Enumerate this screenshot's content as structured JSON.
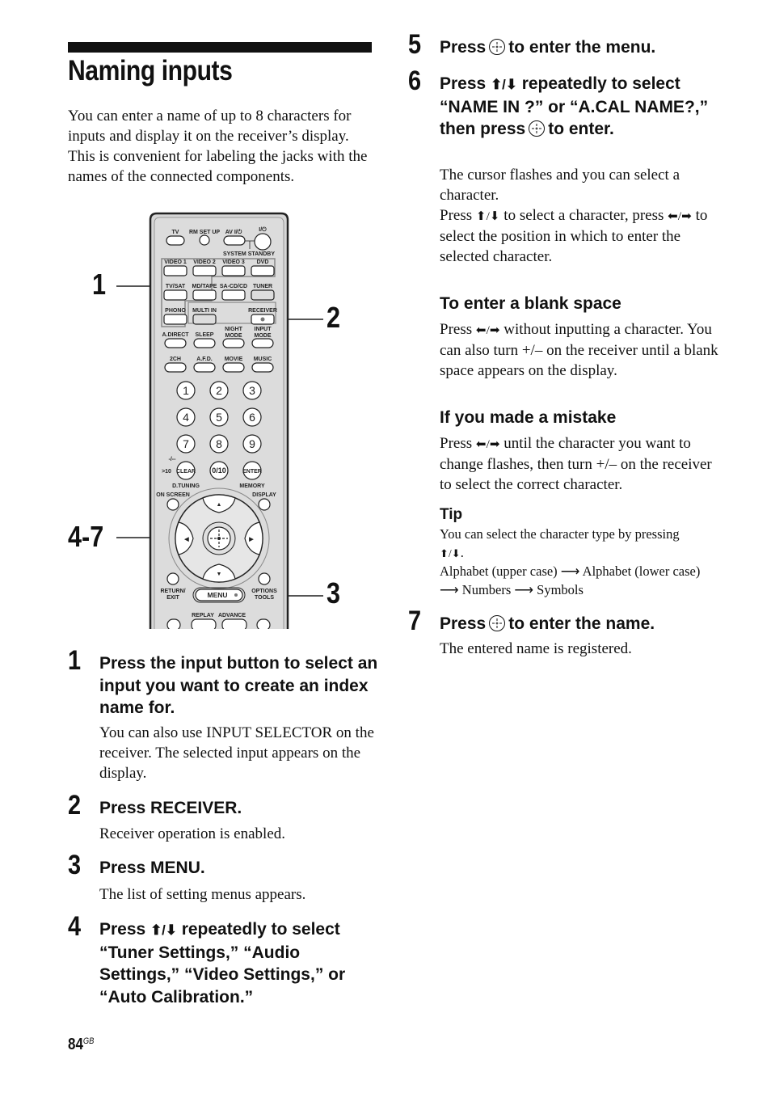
{
  "page": {
    "title": "Naming inputs",
    "intro": "You can enter a name of up to 8 characters for inputs and display it on the receiver’s display. This is convenient for labeling the jacks with the names of the connected components.",
    "page_number": "84",
    "page_suffix": "GB"
  },
  "figure": {
    "callouts": [
      "1",
      "2",
      "3",
      "4-7"
    ],
    "remote": {
      "top_labels": [
        "TV",
        "RM SET UP",
        "AV I/⏻",
        "I/⏻"
      ],
      "system_standby": "SYSTEM STANDBY",
      "input_rows": [
        [
          "VIDEO 1",
          "VIDEO 2",
          "VIDEO 3",
          "DVD"
        ],
        [
          "TV/SAT",
          "MD/TAPE",
          "SA-CD/CD",
          "TUNER"
        ],
        [
          "PHONO",
          "MULTI IN",
          "",
          "RECEIVER"
        ]
      ],
      "mode_row": [
        "A.DIRECT",
        "SLEEP",
        "NIGHT MODE",
        "INPUT MODE"
      ],
      "sound_row": [
        "2CH",
        "A.F.D.",
        "MOVIE",
        "MUSIC"
      ],
      "numbers": [
        "1",
        "2",
        "3",
        "4",
        "5",
        "6",
        "7",
        "8",
        "9"
      ],
      "bottom_num_row": [
        "CLEAR",
        "0/10",
        "ENTER"
      ],
      "gt10": ">10",
      "dash": "-/--",
      "d_tuning": "D.TUNING",
      "memory": "MEMORY",
      "on_screen": "ON SCREEN",
      "display": "DISPLAY",
      "return_exit": "RETURN/ EXIT",
      "menu": "MENU",
      "options_tools": "OPTIONS TOOLS",
      "replay": "REPLAY",
      "advance": "ADVANCE"
    }
  },
  "steps": [
    {
      "number": "1",
      "heading": "Press the input button to select an input you want to create an index name for.",
      "body": "You can also use INPUT SELECTOR on the receiver. The selected input appears on the display."
    },
    {
      "number": "2",
      "heading": "Press RECEIVER.",
      "body": "Receiver operation is enabled."
    },
    {
      "number": "3",
      "heading": "Press MENU.",
      "body": "The list of setting menus appears."
    },
    {
      "number": "4",
      "heading_pre": "Press",
      "heading_post": "repeatedly to select “Tuner Settings,” “Audio Settings,” “Video Settings,” or “Auto Calibration.”"
    },
    {
      "number": "5",
      "heading_pre": "Press",
      "heading_post": "to enter the menu."
    },
    {
      "number": "6",
      "heading_pre": "Press",
      "heading_mid": "repeatedly to select “NAME IN ?” or “A.CAL NAME?,” then press",
      "heading_post": "to enter.",
      "body_1": "The cursor flashes and you can select a character.",
      "body_2_pre": "Press",
      "body_2_mid": "to select a character, press",
      "body_2_post": "to select the position in which to enter the selected character."
    },
    {
      "number": "7",
      "heading_pre": "Press",
      "heading_post": "to enter the name.",
      "body": "The entered name is registered."
    }
  ],
  "blank_space": {
    "heading": "To enter a blank space",
    "body_pre": "Press",
    "body_post": "without inputting a character. You can also turn +/– on the receiver until a blank space appears on the display."
  },
  "mistake": {
    "heading": "If you made a mistake",
    "body_pre": "Press",
    "body_post": "until the character you want to change flashes, then turn +/– on the receiver to select the correct character."
  },
  "tip": {
    "heading": "Tip",
    "line1": "You can select the character type by pressing",
    "line3": "Alphabet (upper case) ⟶ Alphabet (lower case) ⟶ Numbers ⟶ Symbols"
  },
  "glyphs": {
    "up_down": "⬆/⬇",
    "left_right": "⬅/➡"
  }
}
